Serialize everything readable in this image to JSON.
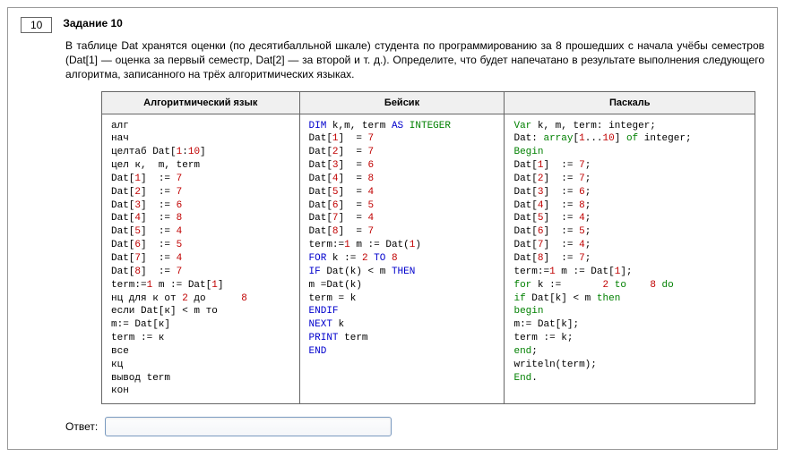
{
  "task_number": "10",
  "task_title": "Задание 10",
  "task_text": "В таблице Dat хранятся оценки (по десятибалльной шкале) студента по программированию за 8 прошедших с начала учёбы семестров (Dat[1] — оценка за первый семестр, Dat[2] — за второй и т. д.). Определите, что будет напечатано в результате выполнения следующего алгоритма, записанного на трёх алгоритмических языках.",
  "headers": {
    "col1": "Алгоритмический язык",
    "col2": "Бейсик",
    "col3": "Паскаль"
  },
  "dat_values": [
    7,
    7,
    6,
    8,
    4,
    5,
    4,
    7
  ],
  "answer_label": "Ответ:",
  "answer_value": ""
}
